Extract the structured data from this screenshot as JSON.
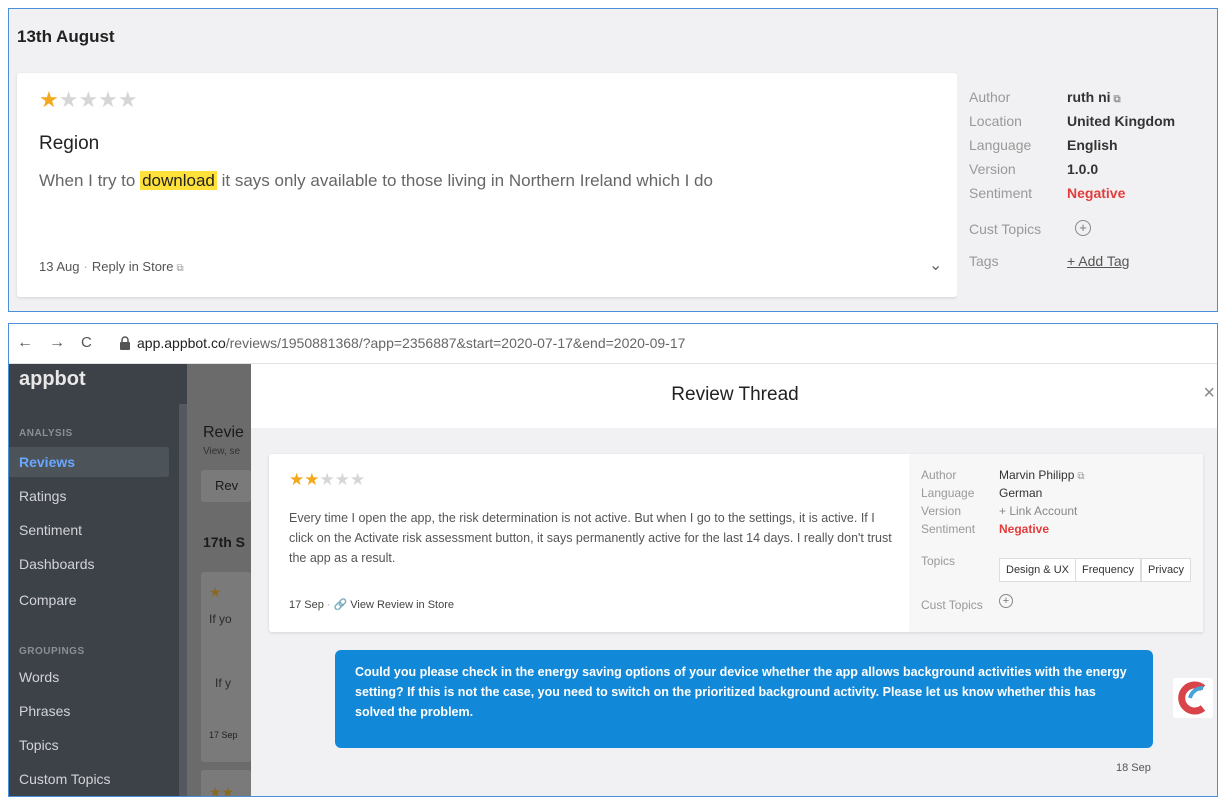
{
  "top": {
    "date_header": "13th August",
    "rating": 1,
    "review_title": "Region",
    "review_text_before": "When I try to ",
    "review_text_highlight": "download",
    "review_text_after": " it says only available to those living in Northern Ireland which I do",
    "footer_date": "13 Aug",
    "footer_dot": "·",
    "reply_label": "Reply in Store",
    "chevron": "⌄",
    "meta": {
      "author_label": "Author",
      "author": "ruth ni",
      "location_label": "Location",
      "location": "United Kingdom",
      "language_label": "Language",
      "language": "English",
      "version_label": "Version",
      "version": "1.0.0",
      "sentiment_label": "Sentiment",
      "sentiment": "Negative",
      "cust_topics_label": "Cust Topics",
      "tags_label": "Tags",
      "add_tag": "+ Add Tag"
    }
  },
  "browser": {
    "back": "←",
    "forward": "→",
    "reload": "C",
    "url_host": "app.appbot.co",
    "url_path": "/reviews/1950881368/?app=2356887&start=2020-07-17&end=2020-09-17"
  },
  "sidebar": {
    "logo": "appbot",
    "analysis_label": "ANALYSIS",
    "groupings_label": "GROUPINGS",
    "analysis_items": [
      "Reviews",
      "Ratings",
      "Sentiment",
      "Dashboards",
      "Compare"
    ],
    "grouping_items": [
      "Words",
      "Phrases",
      "Topics",
      "Custom Topics"
    ]
  },
  "background": {
    "page_title": "Revie",
    "page_sub": "View, se",
    "tab": "Rev",
    "date": "17th S",
    "card_text": "If yo",
    "card_inner": "If y",
    "card_date": "17 Sep"
  },
  "modal": {
    "title": "Review Thread",
    "close": "×",
    "review": {
      "rating": 2,
      "text": "Every time I open the app, the risk determination is not active. But when I go to the settings, it is active. If I click on the Activate risk assessment button, it says permanently active for the last 14 days. I really don't trust the app as a result.",
      "date": "17 Sep",
      "dot": "·",
      "view_link": "View Review in Store"
    },
    "meta": {
      "author_label": "Author",
      "author": "Marvin Philipp",
      "language_label": "Language",
      "language": "German",
      "version_label": "Version",
      "version": "+ Link Account",
      "sentiment_label": "Sentiment",
      "sentiment": "Negative",
      "topics_label": "Topics",
      "topics": [
        "Design & UX",
        "Frequency",
        "Privacy"
      ],
      "cust_topics_label": "Cust Topics"
    },
    "reply": {
      "text": "Could you please check in the energy saving options of your device whether the app allows background activities with the energy setting? If this is not the case, you need to switch on the prioritized background activity. Please let us know whether this has solved the problem.",
      "date": "18 Sep"
    }
  },
  "colors": {
    "accent": "#4a8fd9",
    "star": "#f3a81e",
    "negative": "#e23d3d",
    "reply_bubble": "#1189d8",
    "sidebar": "#3d4148",
    "highlight": "#ffe13a"
  }
}
